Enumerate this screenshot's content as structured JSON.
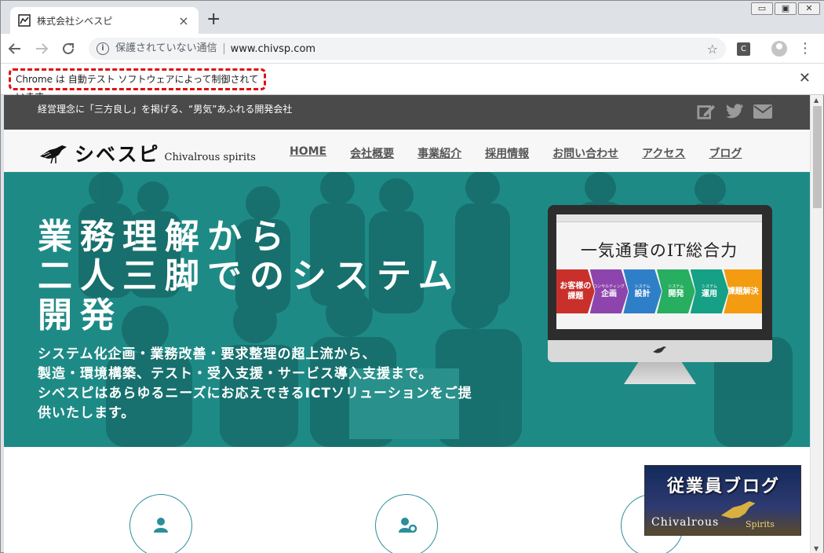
{
  "browser": {
    "tab_title": "株式会社シベスピ",
    "tab_close": "×",
    "new_tab": "+",
    "window_controls": [
      "▭",
      "▣",
      "✕"
    ],
    "secure_label": "保護されていない通信",
    "url": "www.chivsp.com",
    "extension_label": "C",
    "infobar_message": "Chrome は 自動テスト ソフトウェアによって制御されています。",
    "infobar_close": "✕"
  },
  "site": {
    "motto": "経営理念に「三方良し」を掲げる、“男気”あふれる開発会社",
    "logo_name": "シベスピ",
    "logo_sub": "Chivalrous spirits",
    "nav": [
      "HOME",
      "会社概要",
      "事業紹介",
      "採用情報",
      "お問い合わせ",
      "アクセス",
      "ブログ"
    ],
    "social_icons": [
      "edit-icon",
      "twitter-icon",
      "mail-icon"
    ]
  },
  "hero": {
    "headline": [
      "業務理解から",
      "二人三脚でのシステム",
      "開発"
    ],
    "description": [
      "システム化企画・業務改善・要求整理の超上流から、",
      "製造・環境構築、テスト・受入支援・サービス導入支援まで。",
      "シベスピはあらゆるニーズにお応えできるICTソリューションをご提",
      "供いたします。"
    ],
    "monitor_tagline": "一気通貫のIT総合力",
    "steps": [
      {
        "small": "",
        "label": "お客様の課題",
        "color": "#c9302c"
      },
      {
        "small": "コンサルティング",
        "label": "企画",
        "color": "#8e44ad"
      },
      {
        "small": "システム",
        "label": "設計",
        "color": "#2f7fc8"
      },
      {
        "small": "システム",
        "label": "開発",
        "color": "#27ae60"
      },
      {
        "small": "システム",
        "label": "運用",
        "color": "#16a085"
      },
      {
        "small": "",
        "label": "課題解決",
        "color": "#f39c12"
      }
    ]
  },
  "banner": {
    "title": "従業員ブログ",
    "sub1": "Chivalrous",
    "sub2": "Spirits"
  }
}
